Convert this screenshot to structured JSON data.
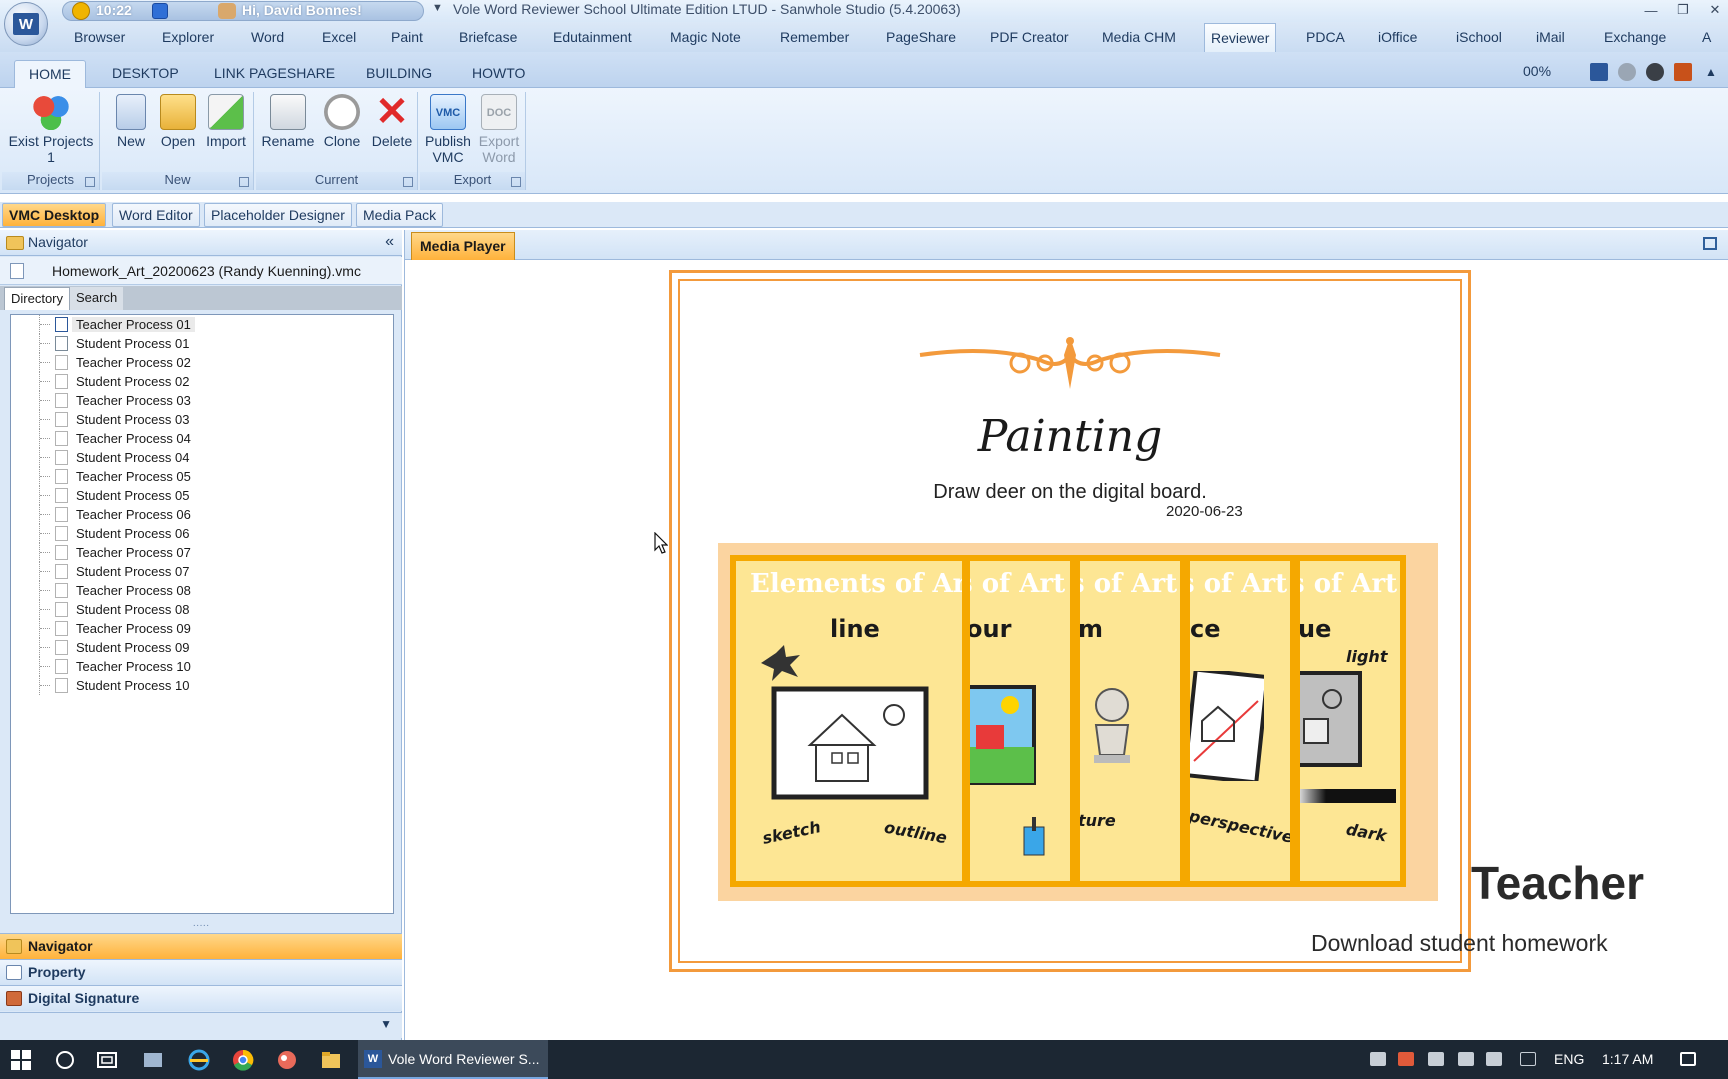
{
  "titlebar": {
    "time": "10:22",
    "greeting": "Hi, David Bonnes!",
    "title": "Vole Word Reviewer School Ultimate Edition LTUD - Sanwhole Studio (5.4.20063)"
  },
  "menu": {
    "items": [
      "Browser",
      "Explorer",
      "Word",
      "Excel",
      "Paint",
      "Briefcase",
      "Edutainment",
      "Magic Note",
      "Remember",
      "PageShare",
      "PDF Creator",
      "Media CHM",
      "Reviewer",
      "PDCA",
      "iOffice",
      "iSchool",
      "iMail",
      "Exchange",
      "A"
    ],
    "active": "Reviewer"
  },
  "ribbon": {
    "tabs": [
      "HOME",
      "DESKTOP",
      "LINK PAGESHARE",
      "BUILDING",
      "HOWTO"
    ],
    "active_tab": "HOME",
    "zoom": "00%",
    "groups": {
      "projects": {
        "label": "Projects",
        "exist_label": "Exist Projects",
        "exist_count": "1"
      },
      "new": {
        "label": "New",
        "new_label": "New",
        "open_label": "Open",
        "import_label": "Import"
      },
      "current": {
        "label": "Current",
        "rename_label": "Rename",
        "clone_label": "Clone",
        "delete_label": "Delete"
      },
      "export": {
        "label": "Export",
        "publish_label": "Publish",
        "publish_sub": "VMC",
        "export_label": "Export",
        "export_sub": "Word",
        "publish_badge": "VMC",
        "export_badge": "DOC"
      }
    }
  },
  "doc_tabs": [
    "VMC Desktop",
    "Word Editor",
    "Placeholder Designer",
    "Media Pack"
  ],
  "navigator": {
    "title": "Navigator",
    "file": "Homework_Art_20200623 (Randy Kuenning).vmc",
    "subtabs": [
      "Directory",
      "Search"
    ],
    "tree": [
      "Teacher Process 01",
      "Student Process 01",
      "Teacher Process 02",
      "Student Process 02",
      "Teacher Process 03",
      "Student Process 03",
      "Teacher Process 04",
      "Student Process 04",
      "Teacher Process 05",
      "Student Process 05",
      "Teacher Process 06",
      "Student Process 06",
      "Teacher Process 07",
      "Student Process 07",
      "Teacher Process 08",
      "Student Process 08",
      "Teacher Process 09",
      "Student Process 09",
      "Teacher Process 10",
      "Student Process 10"
    ],
    "selected": "Teacher Process 01",
    "accordion": [
      "Navigator",
      "Property",
      "Digital Signature"
    ]
  },
  "media_player": {
    "tab": "Media Player",
    "slide_title": "Painting",
    "slide_subtitle": "Draw deer on the digital board.",
    "slide_date": "2020-06-23",
    "posters": [
      {
        "head": "Elements of Art",
        "word": "line",
        "tags": [
          "sketch",
          "outline"
        ]
      },
      {
        "head": "s of Art",
        "word": "our",
        "tags": []
      },
      {
        "head": "s of Art",
        "word": "m",
        "tags": [
          "ture"
        ]
      },
      {
        "head": "s of Art",
        "word": "ce",
        "tags": [
          "perspective"
        ]
      },
      {
        "head": "s of Art",
        "word": "ue",
        "tags": [
          "light",
          "dark"
        ]
      }
    ],
    "overlay_title": "Teacher",
    "overlay_subtitle": "Download student homework"
  },
  "taskbar": {
    "app_label": "Vole Word Reviewer S...",
    "language": "ENG",
    "clock": "1:17 AM"
  },
  "colors": {
    "accent_orange": "#f39a3c",
    "ribbon_blue": "#dbe8f7",
    "active_tab_gold": "#ffb23b",
    "poster_yellow": "#fde694"
  }
}
